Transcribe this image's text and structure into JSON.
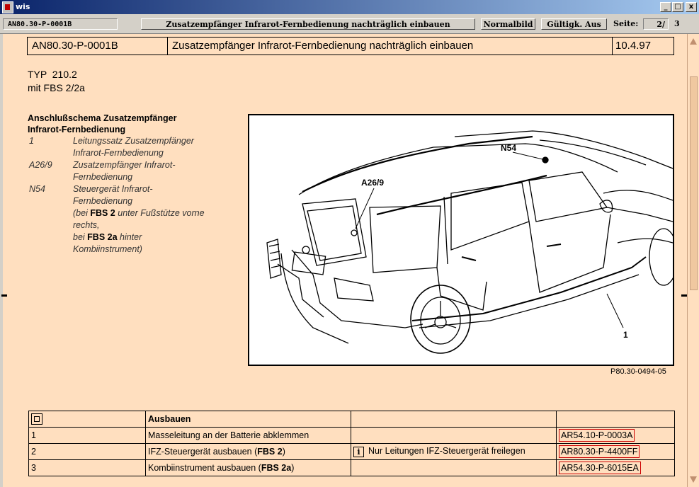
{
  "window": {
    "title": "wis",
    "minimize": "_",
    "maximize": "□",
    "close": "x"
  },
  "toolbar": {
    "doc_id": "AN80.30-P-0001B",
    "doc_title": "Zusatzempfänger Infrarot-Fernbedienung nachträglich einbauen",
    "normalbild": "Normalbild",
    "gueltigkeit": "Gültigk. Aus",
    "seite_label": "Seite:",
    "page_current": "2/",
    "page_total": "3"
  },
  "header": {
    "doc_id": "AN80.30-P-0001B",
    "title": "Zusatzempfänger Infrarot-Fernbedienung nachträglich einbauen",
    "date": "10.4.97"
  },
  "typ": {
    "line1": "TYP  210.2",
    "line2": "mit FBS 2/2a"
  },
  "schema": {
    "heading1": "Anschlußschema Zusatzempfänger",
    "heading2": "Infrarot-Fernbedienung",
    "legend": [
      {
        "key": "1",
        "lines": [
          "Leitungssatz Zusatzempfänger",
          "Infrarot-Fernbedienung"
        ]
      },
      {
        "key": "A26/9",
        "lines": [
          "Zusatzempfänger Infrarot-",
          "Fernbedienung"
        ]
      },
      {
        "key": "N54",
        "lines": [
          "Steuergerät Infrarot-",
          "Fernbedienung"
        ],
        "note": {
          "p1": "(bei ",
          "b1": "FBS 2",
          "p2": " unter Fußstütze vorne",
          "p3": "rechts,",
          "p4": "bei ",
          "b2": "FBS 2a",
          "p5": " hinter",
          "p6": "Kombiinstrument)"
        }
      }
    ]
  },
  "figure": {
    "label_n54": "N54",
    "label_a26": "A26/9",
    "label_1": "1",
    "ref": "P80.30-0494-05"
  },
  "steps": {
    "heading": "Ausbauen",
    "rows": [
      {
        "no": "1",
        "text": "Masseleitung an der Batterie abklemmen",
        "text_bold": "",
        "text_end": "",
        "note": "",
        "ref": "AR54.10-P-0003A"
      },
      {
        "no": "2",
        "text": "IFZ-Steuergerät ausbauen (",
        "text_bold": "FBS 2",
        "text_end": ")",
        "note": "Nur Leitungen IFZ-Steuergerät freilegen",
        "ref": "AR80.30-P-4400FF"
      },
      {
        "no": "3",
        "text": "Kombiinstrument ausbauen (",
        "text_bold": "FBS 2a",
        "text_end": ")",
        "note": "",
        "ref": "AR54.30-P-6015EA"
      }
    ],
    "info_glyph": "i"
  }
}
